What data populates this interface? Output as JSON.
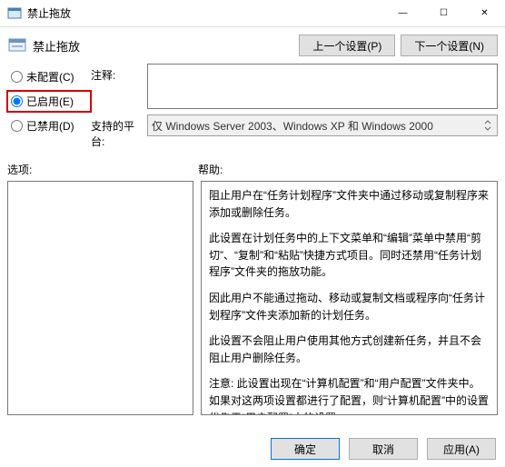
{
  "window": {
    "title": "禁止拖放",
    "minimize": "—",
    "maximize": "☐",
    "close": "✕"
  },
  "header": {
    "title": "禁止拖放",
    "prev_btn": "上一个设置(P)",
    "next_btn": "下一个设置(N)"
  },
  "radios": {
    "not_configured": "未配置(C)",
    "enabled": "已启用(E)",
    "disabled": "已禁用(D)"
  },
  "fields": {
    "comment_label": "注释:",
    "comment_value": "",
    "platform_label": "支持的平台:",
    "platform_value": "仅 Windows Server 2003、Windows XP 和 Windows 2000"
  },
  "sections": {
    "options_label": "选项:",
    "help_label": "帮助:"
  },
  "help_paragraphs": {
    "p1": "阻止用户在“任务计划程序”文件夹中通过移动或复制程序来添加或删除任务。",
    "p2": "此设置在计划任务中的上下文菜单和“编辑”菜单中禁用“剪切”、“复制”和“粘贴”快捷方式项目。同时还禁用“任务计划程序”文件夹的拖放功能。",
    "p3": "因此用户不能通过拖动、移动或复制文档或程序向“任务计划程序”文件夹添加新的计划任务。",
    "p4": "此设置不会阻止用户使用其他方式创建新任务，并且不会阻止用户删除任务。",
    "p5": "注意: 此设置出现在“计算机配置”和“用户配置”文件夹中。如果对这两项设置都进行了配置，则“计算机配置”中的设置优先于“用户配置”中的设置。"
  },
  "footer": {
    "ok": "确定",
    "cancel": "取消",
    "apply": "应用(A)"
  }
}
